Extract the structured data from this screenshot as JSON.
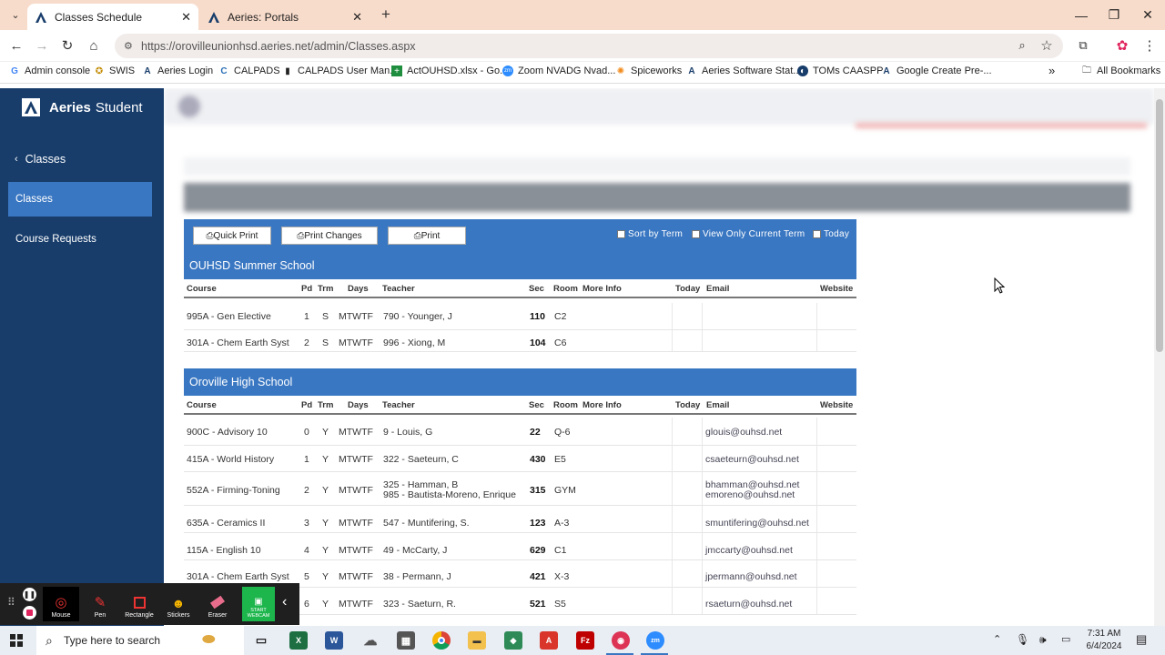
{
  "browser": {
    "tabs": [
      {
        "title": "Classes Schedule",
        "active": true
      },
      {
        "title": "Aeries: Portals",
        "active": false
      }
    ],
    "new_tab": "+",
    "url": "https://orovilleunionhsd.aeries.net/admin/Classes.aspx",
    "bookmarks": [
      {
        "label": "Admin console",
        "icon": "google-icon"
      },
      {
        "label": "SWIS",
        "icon": "swis-icon"
      },
      {
        "label": "Aeries Login",
        "icon": "aeries-icon"
      },
      {
        "label": "CALPADS",
        "icon": "calpads-icon"
      },
      {
        "label": "CALPADS User Man...",
        "icon": "book-icon"
      },
      {
        "label": "ActOUHSD.xlsx - Go...",
        "icon": "sheets-icon"
      },
      {
        "label": "Zoom NVADG Nvad...",
        "icon": "zoom-icon"
      },
      {
        "label": "Spiceworks",
        "icon": "spiceworks-icon"
      },
      {
        "label": "Aeries Software Stat...",
        "icon": "aeries-icon"
      },
      {
        "label": "TOMs CAASPP",
        "icon": "toms-icon"
      },
      {
        "label": "Google Create Pre-...",
        "icon": "aeries-icon"
      }
    ],
    "more_bookmarks": "»",
    "all_bookmarks": "All Bookmarks"
  },
  "app": {
    "brand_bold": "Aeries",
    "brand_rest": "Student",
    "back_label": "Classes",
    "nav": [
      {
        "label": "Classes",
        "active": true
      },
      {
        "label": "Course Requests",
        "active": false
      }
    ]
  },
  "toolbar": {
    "quick_print": "Quick Print",
    "print_changes": "Print Changes",
    "print": "Print",
    "sort_by_term": "Sort by Term",
    "view_only_current_term": "View Only Current Term",
    "today": "Today"
  },
  "columns": [
    "Course",
    "Pd",
    "Trm",
    "Days",
    "Teacher",
    "Sec",
    "Room",
    "More Info",
    "Today",
    "Email",
    "Website"
  ],
  "schools": [
    {
      "name": "OUHSD Summer School",
      "rows": [
        {
          "course": "995A - Gen Elective",
          "pd": "1",
          "trm": "S",
          "days": "MTWTF",
          "teacher": "790 - Younger, J",
          "sec": "110",
          "room": "C2",
          "email": ""
        },
        {
          "course": "301A - Chem Earth Syst",
          "pd": "2",
          "trm": "S",
          "days": "MTWTF",
          "teacher": "996 - Xiong, M",
          "sec": "104",
          "room": "C6",
          "email": ""
        }
      ]
    },
    {
      "name": "Oroville High School",
      "rows": [
        {
          "course": "900C - Advisory 10",
          "pd": "0",
          "trm": "Y",
          "days": "MTWTF",
          "teacher": "9 - Louis, G",
          "sec": "22",
          "room": "Q-6",
          "email": "glouis@ouhsd.net"
        },
        {
          "course": "415A - World History",
          "pd": "1",
          "trm": "Y",
          "days": "MTWTF",
          "teacher": "322 - Saeteurn, C",
          "sec": "430",
          "room": "E5",
          "email": "csaeteurn@ouhsd.net"
        },
        {
          "course": "552A - Firming-Toning",
          "pd": "2",
          "trm": "Y",
          "days": "MTWTF",
          "teacher": "325 - Hamman, B",
          "teacher2": "985 - Bautista-Moreno, Enrique",
          "sec": "315",
          "room": "GYM",
          "email": "bhamman@ouhsd.net",
          "email2": "emoreno@ouhsd.net"
        },
        {
          "course": "635A - Ceramics II",
          "pd": "3",
          "trm": "Y",
          "days": "MTWTF",
          "teacher": "547 - Muntifering, S.",
          "sec": "123",
          "room": "A-3",
          "email": "smuntifering@ouhsd.net"
        },
        {
          "course": "115A - English 10",
          "pd": "4",
          "trm": "Y",
          "days": "MTWTF",
          "teacher": "49 - McCarty, J",
          "sec": "629",
          "room": "C1",
          "email": "jmccarty@ouhsd.net"
        },
        {
          "course": "301A - Chem Earth Syst",
          "pd": "5",
          "trm": "Y",
          "days": "MTWTF",
          "teacher": "38 - Permann, J",
          "sec": "421",
          "room": "X-3",
          "email": "jpermann@ouhsd.net"
        },
        {
          "course": "",
          "pd": "6",
          "trm": "Y",
          "days": "MTWTF",
          "teacher": "323 - Saeturn, R.",
          "sec": "521",
          "room": "S5",
          "email": "rsaeturn@ouhsd.net"
        }
      ]
    }
  ],
  "zoom_tools": [
    "Mouse",
    "Pen",
    "Rectangle",
    "Stickers",
    "Eraser",
    "START WEBCAM"
  ],
  "taskbar": {
    "search_placeholder": "Type here to search",
    "time": "7:31 AM",
    "date": "6/4/2024"
  }
}
